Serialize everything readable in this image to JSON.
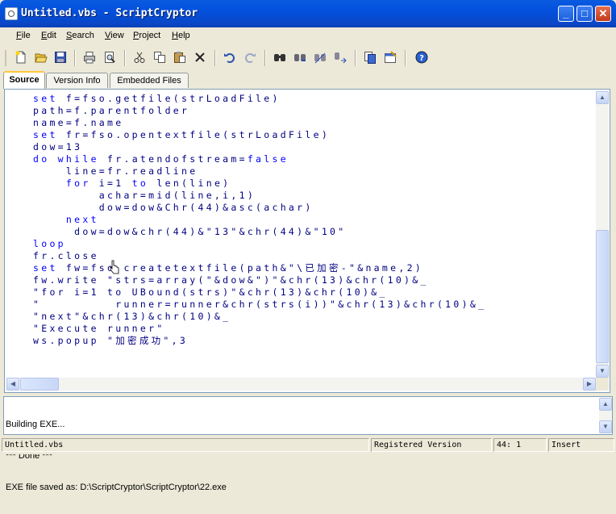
{
  "window": {
    "title": "Untitled.vbs - ScriptCryptor",
    "minimize_glyph": "_",
    "maximize_glyph": "□",
    "close_glyph": "✕"
  },
  "menu": [
    {
      "key": "F",
      "rest": "ile"
    },
    {
      "key": "E",
      "rest": "dit"
    },
    {
      "key": "S",
      "rest": "earch"
    },
    {
      "key": "V",
      "rest": "iew"
    },
    {
      "key": "P",
      "rest": "roject"
    },
    {
      "key": "H",
      "rest": "elp"
    }
  ],
  "toolbar_icons": [
    "new-file-icon",
    "open-folder-icon",
    "save-icon",
    "print-icon",
    "print-preview-icon",
    "cut-icon",
    "copy-icon",
    "paste-icon",
    "delete-icon",
    "undo-icon",
    "redo-icon",
    "find-icon",
    "find-next-icon",
    "replace-icon",
    "goto-icon",
    "build-exe-icon",
    "options-icon",
    "help-icon"
  ],
  "tabs": [
    {
      "label": "Source",
      "active": true
    },
    {
      "label": "Version Info",
      "active": false
    },
    {
      "label": "Embedded Files",
      "active": false
    }
  ],
  "code_lines": [
    [
      {
        "k": "set"
      },
      {
        "t": " f=fso.getfile(strLoadFile)"
      }
    ],
    [
      {
        "t": "path=f.parentfolder"
      }
    ],
    [
      {
        "t": "name=f.name"
      }
    ],
    [
      {
        "k": "set"
      },
      {
        "t": " fr=fso.opentextfile(strLoadFile)"
      }
    ],
    [
      {
        "t": "dow=13"
      }
    ],
    [
      {
        "k": "do while"
      },
      {
        "t": " fr.atendofstream="
      },
      {
        "k": "false"
      }
    ],
    [
      {
        "t": "    line=fr.readline"
      }
    ],
    [
      {
        "t": "    "
      },
      {
        "k": "for"
      },
      {
        "t": " i=1 "
      },
      {
        "k": "to"
      },
      {
        "t": " len(line)"
      }
    ],
    [
      {
        "t": "        achar=mid(line,i,1)"
      }
    ],
    [
      {
        "t": "        dow=dow&Chr(44)&asc(achar)"
      }
    ],
    [
      {
        "t": "    "
      },
      {
        "k": "next"
      }
    ],
    [
      {
        "t": "     dow=dow&chr(44)&\"13\"&chr(44)&\"10\""
      }
    ],
    [
      {
        "k": "loop"
      }
    ],
    [
      {
        "t": "fr.close"
      }
    ],
    [
      {
        "k": "set"
      },
      {
        "t": " fw=fso.createtextfile(path&\"\\已加密-\"&name,2)"
      }
    ],
    [
      {
        "t": "fw.write \"strs=array(\"&dow&\")\"&chr(13)&chr(10)&_"
      }
    ],
    [
      {
        "t": "\"for i=1 to UBound(strs)\"&chr(13)&chr(10)&_"
      }
    ],
    [
      {
        "t": "\"         runner=runner&chr(strs(i))\"&chr(13)&chr(10)&_"
      }
    ],
    [
      {
        "t": "\"next\"&chr(13)&chr(10)&_"
      }
    ],
    [
      {
        "t": "\"Execute runner\""
      }
    ],
    [
      {
        "t": "ws.popup \"加密成功\",3"
      }
    ]
  ],
  "output_lines": [
    "Building EXE...",
    "*** Done ***",
    "EXE file saved as: D:\\ScriptCryptor\\ScriptCryptor\\22.exe"
  ],
  "status": {
    "file": "Untitled.vbs",
    "registration": "Registered Version",
    "position": "44: 1",
    "mode": "Insert"
  },
  "colors": {
    "keyword": "#0000ff",
    "identifier": "#000080",
    "titlebar": "#0350DD"
  }
}
